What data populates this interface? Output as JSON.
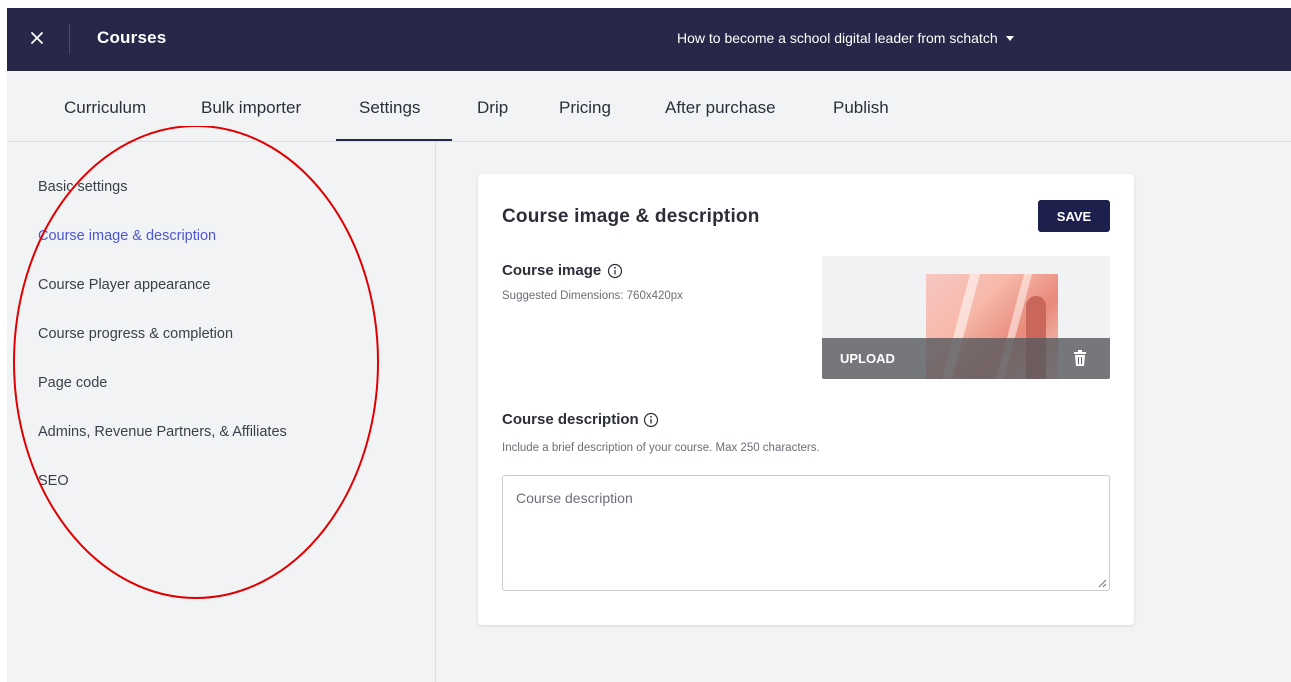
{
  "topbar": {
    "title": "Courses",
    "course_selector": "How to become a school digital leader from schatch"
  },
  "tabs": [
    {
      "label": "Curriculum"
    },
    {
      "label": "Bulk importer"
    },
    {
      "label": "Settings",
      "active": true
    },
    {
      "label": "Drip"
    },
    {
      "label": "Pricing"
    },
    {
      "label": "After purchase"
    },
    {
      "label": "Publish"
    }
  ],
  "sidebar": {
    "items": [
      {
        "label": "Basic settings"
      },
      {
        "label": "Course image & description",
        "active": true
      },
      {
        "label": "Course Player appearance"
      },
      {
        "label": "Course progress & completion"
      },
      {
        "label": "Page code"
      },
      {
        "label": "Admins, Revenue Partners, & Affiliates"
      },
      {
        "label": "SEO"
      }
    ]
  },
  "card": {
    "title": "Course image & description",
    "save_label": "SAVE",
    "image": {
      "label": "Course image",
      "helper": "Suggested Dimensions: 760x420px",
      "upload_label": "UPLOAD"
    },
    "description": {
      "label": "Course description",
      "helper": "Include a brief description of your course. Max 250 characters.",
      "placeholder": "Course description",
      "value": ""
    }
  },
  "colors": {
    "topbar_bg": "#272849",
    "active_link": "#4a56d8",
    "save_bg": "#1d1f4d",
    "annotation": "#e00000"
  }
}
